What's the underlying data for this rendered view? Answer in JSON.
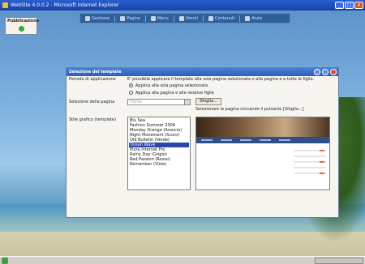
{
  "window": {
    "title": "WebSite 4.0.0.2 - Microsoft Internet Explorer",
    "buttons": {
      "minimize": "_",
      "maximize": "□",
      "close": "×"
    }
  },
  "side_panel": {
    "title": "Pubblicazione",
    "icon": "globe-icon"
  },
  "toolbar": {
    "items": [
      {
        "label": "Gestione",
        "icon": "home-icon"
      },
      {
        "label": "Pagine",
        "icon": "page-icon"
      },
      {
        "label": "Menu",
        "icon": "menu-icon"
      },
      {
        "label": "Utenti",
        "icon": "users-icon"
      },
      {
        "label": "Contenuti",
        "icon": "folder-icon"
      },
      {
        "label": "Aiuto",
        "icon": "help-icon"
      }
    ]
  },
  "dialog": {
    "title": "Selezione del template",
    "scope_label": "Periodo di applicazione",
    "scope_description": "E' possibile applicare il template alla sola pagina selezionata o alla pagina e a tutte le figlie.",
    "radio_options": [
      {
        "label": "Applica alla sola pagina selezionata",
        "checked": true
      },
      {
        "label": "Applica alla pagina e alle relative figlie",
        "checked": false
      }
    ],
    "page_select_label": "Selezione della pagina",
    "page_select_value": "Home",
    "browse_button": "Sfoglia...",
    "page_select_hint": "Selezionare la pagina cliccando il pulsante [Sfoglia...]",
    "style_label": "Stile grafico (template)",
    "templates": [
      "Blu Sea",
      "Fashion Summer 2004",
      "Monday Orange (Arancio)",
      "Night Movement (Scuro)",
      "Old Bulletin (Verde)",
      "Ocean Wave",
      "Pizza Internet Pro",
      "Rainy Day (Grigio)",
      "Red Passion (Rosso)",
      "Remember (Viola)"
    ],
    "selected_template_index": 5
  },
  "colors": {
    "titlebar": "#1f4fbf",
    "dialog_header": "#3a6cc8",
    "selection": "#2b46a8",
    "accent_orange": "#e2703a"
  }
}
